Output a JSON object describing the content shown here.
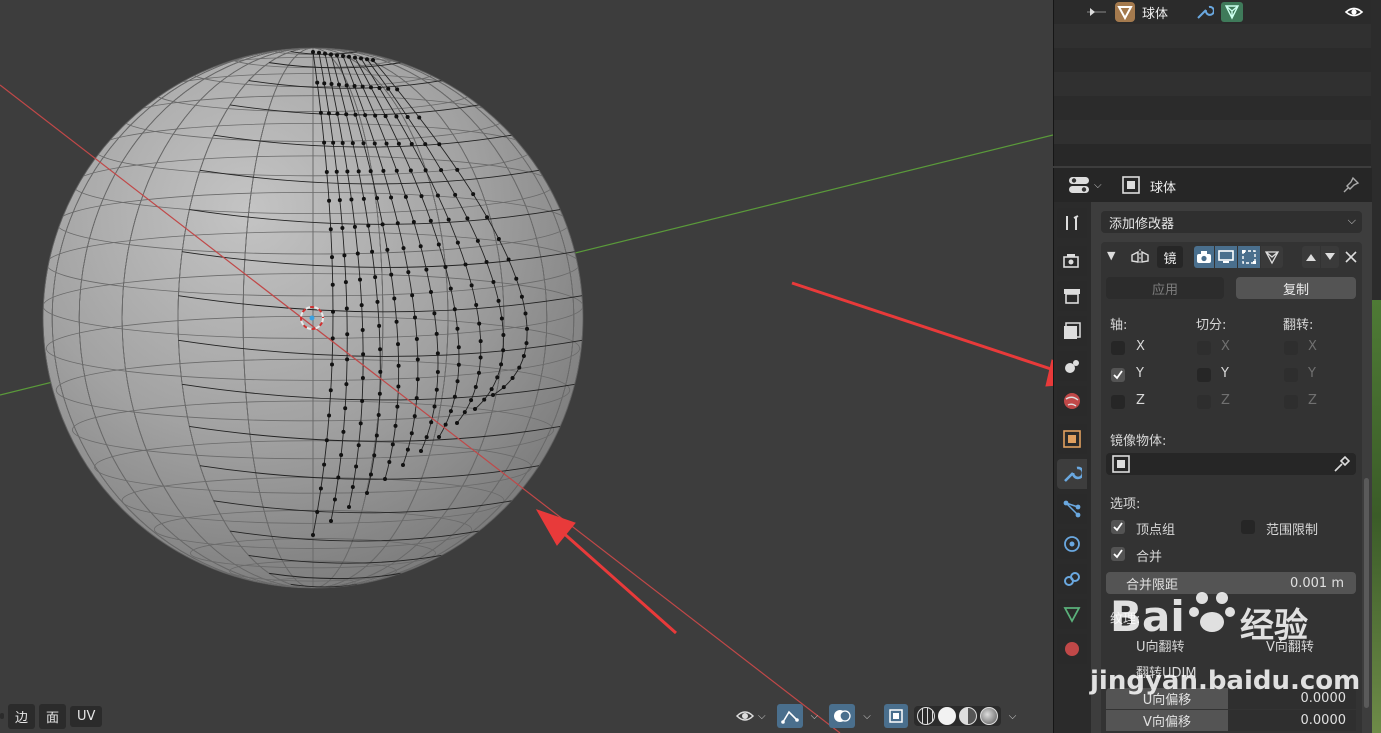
{
  "outliner": {
    "object_name": "球体"
  },
  "properties": {
    "object_name": "球体",
    "add_modifier": "添加修改器",
    "modifier": {
      "name": "镜",
      "apply": "应用",
      "duplicate": "复制",
      "axis_label": "轴:",
      "bisect_label": "切分:",
      "flip_label": "翻转:",
      "axes": [
        "X",
        "Y",
        "Z"
      ],
      "mirror_object_label": "镜像物体:",
      "options_label": "选项:",
      "vertex_groups": "顶点组",
      "clipping": "范围限制",
      "merge": "合并",
      "merge_distance_label": "合并限距",
      "merge_distance_value": "0.001 m",
      "texture_label": "纹理:",
      "u_flip": "U向翻转",
      "v_flip": "V向翻转",
      "flip_udim": "翻转UDIM",
      "u_offset_label": "U向偏移",
      "u_offset_value": "0.0000",
      "v_offset_label": "V向偏移",
      "v_offset_value": "0.0000"
    }
  },
  "viewport": {
    "select_modes": [
      "边",
      "面",
      "UV"
    ]
  },
  "watermark": {
    "logo": "Bai",
    "logo_cn": "经验",
    "url": "jingyan.baidu.com"
  },
  "colors": {
    "accent": "#4a6f8d",
    "arrow": "#e83a3a",
    "x_axis": "#c04848",
    "y_axis": "#5a9a3a"
  }
}
